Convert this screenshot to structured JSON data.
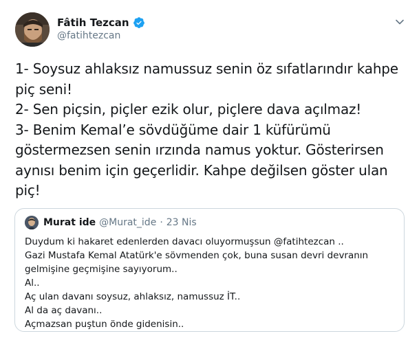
{
  "author": {
    "name": "Fâtih Tezcan",
    "handle": "@fatihtezcan",
    "verified": true,
    "avatar_icon": "user-photo-avatar"
  },
  "tweet": {
    "lines": [
      "1- Soysuz ahlaksız namussuz senin öz sıfatlarındır kahpe",
      "piç seni!",
      "2- Sen piçsin, piçler ezik olur, piçlere dava açılmaz!",
      "3- Benim Kemal’e sövdüğüme dair 1 küfürümü",
      "göstermezsen senin ırzında namus yoktur. Gösterirsen",
      "aynısı benim için geçerlidir. Kahpe değilsen göster ulan",
      "piç!"
    ]
  },
  "quoted": {
    "name": "Murat ide",
    "handle": "@Murat_ide",
    "separator": "·",
    "date": "23 Nis",
    "lines": [
      "Duydum ki hakaret edenlerden davacı oluyormuşsun @fatihtezcan ..",
      "Gazi Mustafa Kemal Atatürk'e sövmenden çok, buna susan devri devranın",
      "gelmişine geçmişine sayıyorum..",
      "Al..",
      "Aç ulan davanı soysuz, ahlaksız, namussuz İT..",
      "Al da aç davanı..",
      "Açmazsan puştun önde gidenisin.."
    ]
  },
  "colors": {
    "text": "#14171a",
    "secondary": "#657786",
    "verified": "#1da1f2",
    "border": "#ccd6dd"
  }
}
